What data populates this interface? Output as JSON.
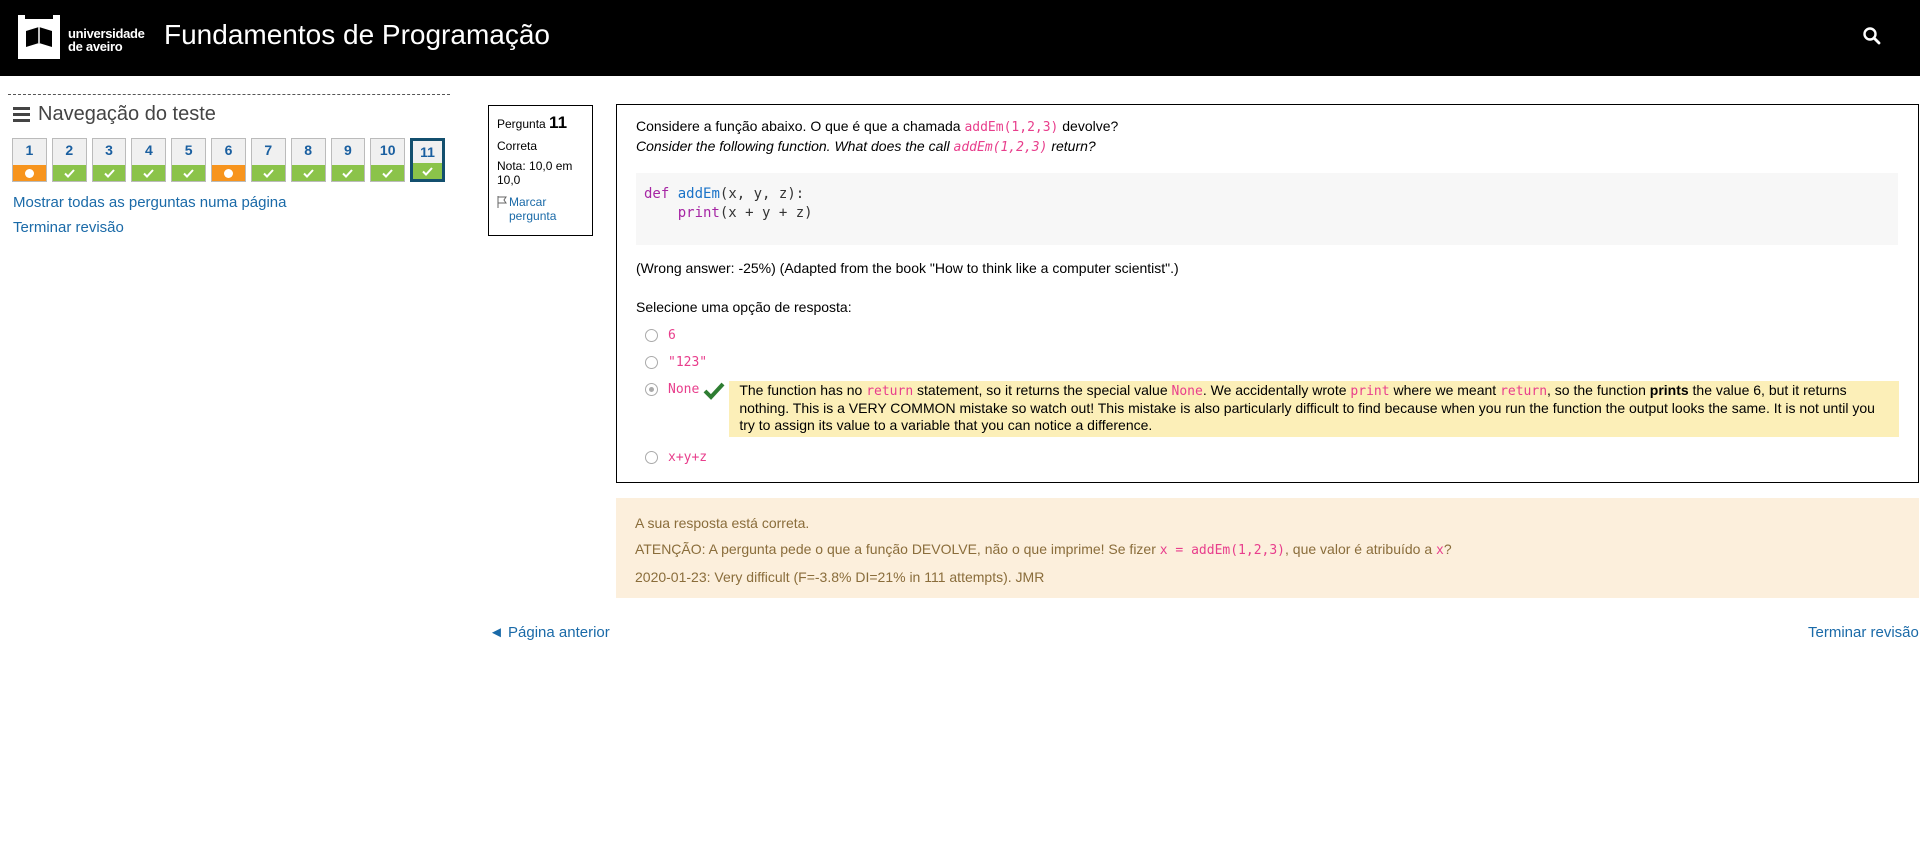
{
  "header": {
    "logo_line1": "universidade",
    "logo_line2": "de aveiro",
    "title": "Fundamentos de Programação",
    "search_icon": "search-icon"
  },
  "sidebar": {
    "heading": "Navegação do teste",
    "questions": [
      {
        "num": "1",
        "state": "partial"
      },
      {
        "num": "2",
        "state": "correct"
      },
      {
        "num": "3",
        "state": "correct"
      },
      {
        "num": "4",
        "state": "correct"
      },
      {
        "num": "5",
        "state": "correct"
      },
      {
        "num": "6",
        "state": "partial"
      },
      {
        "num": "7",
        "state": "correct"
      },
      {
        "num": "8",
        "state": "correct"
      },
      {
        "num": "9",
        "state": "correct"
      },
      {
        "num": "10",
        "state": "correct"
      },
      {
        "num": "11",
        "state": "correct",
        "current": true
      }
    ],
    "show_all_link": "Mostrar todas as perguntas numa página",
    "finish_link": "Terminar revisão"
  },
  "qinfo": {
    "label": "Pergunta",
    "number": "11",
    "state": "Correta",
    "grade": "Nota: 10,0 em 10,0",
    "flag": "Marcar pergunta"
  },
  "question": {
    "pt_before": "Considere a função abaixo. O que é que a chamada ",
    "pt_code": "addEm(1,2,3)",
    "pt_after": " devolve?",
    "en_before": "Consider the following function. What does the call ",
    "en_code": "addEm(1,2,3)",
    "en_after": " return?",
    "code_def": "def",
    "code_fname": "addEm",
    "code_params": "(x, y, z):",
    "code_print": "print",
    "code_body": "(x + y + z)",
    "note": "(Wrong answer: -25%) (Adapted from the book \"How to think like a computer scientist\".)",
    "prompt": "Selecione uma opção de resposta:",
    "options": [
      "6",
      "\"123\"",
      "None",
      "x+y+z"
    ],
    "selected_index": 2,
    "feedback": {
      "t1": "The function has no ",
      "c1": "return",
      "t2": " statement, so it returns the special value ",
      "c2": "None",
      "t3": ". We accidentally wrote ",
      "c3": "print",
      "t4": " where we meant ",
      "c4": "return",
      "t5": ", so the function ",
      "b1": "prints",
      "t6": " the value 6, but it returns nothing. This is a VERY COMMON mistake so watch out! This mistake is also particularly difficult to find because when you run the function the output looks the same. It is not until you try to assign its value to a variable that you can notice a difference."
    }
  },
  "outcome": {
    "line1": "A sua resposta está correta.",
    "line2_a": "ATENÇÃO: A pergunta pede o que a função DEVOLVE, não o que imprime! Se fizer ",
    "line2_code1": "x = addEm(1,2,3)",
    "line2_b": ", que valor é atribuído a ",
    "line2_code2": "x",
    "line2_c": "?",
    "line3": "2020-01-23: Very difficult (F=-3.8% DI=21% in 111 attempts). JMR"
  },
  "footer": {
    "prev": "◄ Página anterior",
    "finish": "Terminar revisão"
  },
  "colors": {
    "correct": "#8bc34a",
    "partial": "#f7941d",
    "link": "#1a6aa8",
    "code": "#e83e8c",
    "feedback_bg": "#fcefb8",
    "outcome_bg": "#fcefdc"
  }
}
